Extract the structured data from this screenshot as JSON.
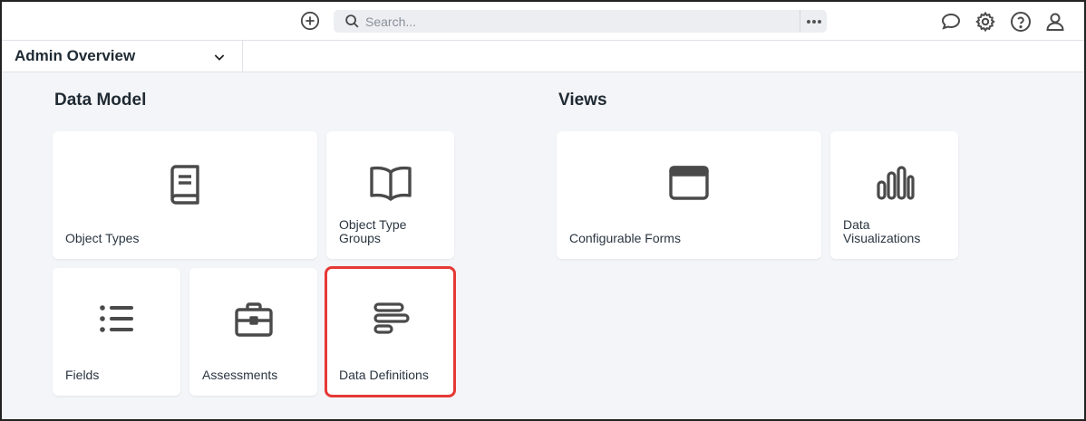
{
  "topbar": {
    "add_icon": "plus-circle-icon",
    "search": {
      "placeholder": "Search...",
      "icon": "search-icon",
      "more_icon": "ellipsis-icon"
    },
    "right_icons": [
      "chat-bubble-icon",
      "gear-icon",
      "help-circle-icon",
      "user-icon"
    ]
  },
  "dashboard_selector": {
    "label": "Admin Overview",
    "icon": "chevron-down-icon"
  },
  "sections": {
    "data_model": {
      "title": "Data Model",
      "tiles": [
        {
          "label": "Object Types",
          "icon": "book-icon"
        },
        {
          "label": "Object Type Groups",
          "icon": "open-book-icon"
        },
        {
          "label": "Fields",
          "icon": "list-icon"
        },
        {
          "label": "Assessments",
          "icon": "briefcase-icon"
        },
        {
          "label": "Data Definitions",
          "icon": "align-left-bars-icon",
          "highlighted": true
        }
      ]
    },
    "views": {
      "title": "Views",
      "tiles": [
        {
          "label": "Configurable Forms",
          "icon": "browser-window-icon"
        },
        {
          "label": "Data Visualizations",
          "icon": "bar-chart-icon"
        }
      ]
    }
  },
  "colors": {
    "icon": "#4a4a4a",
    "highlight": "#e53935",
    "background": "#f4f5f8"
  }
}
